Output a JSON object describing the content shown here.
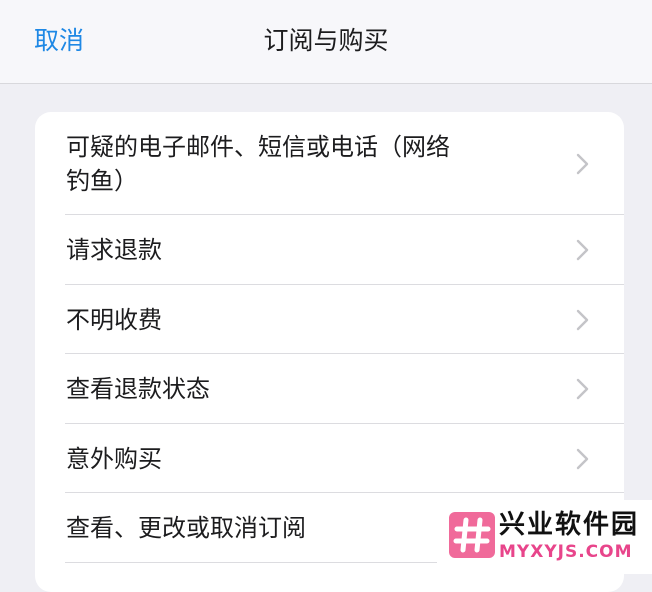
{
  "nav": {
    "cancel_label": "取消",
    "title": "订阅与购买"
  },
  "menu": {
    "items": [
      {
        "label": "可疑的电子邮件、短信或电话（网络钓鱼）",
        "lines": [
          "可疑的电子邮件、短信或电话（网络",
          "钓鱼）"
        ]
      },
      {
        "label": "请求退款"
      },
      {
        "label": "不明收费"
      },
      {
        "label": "查看退款状态"
      },
      {
        "label": "意外购买"
      },
      {
        "label": "查看、更改或取消订阅"
      }
    ]
  },
  "watermark": {
    "title": "兴业软件园",
    "subtitle": "MYXYJS.COM"
  },
  "colors": {
    "accent": "#1e88e5",
    "background": "#efeff4",
    "watermark_pink": "#e8458b"
  },
  "icons": {
    "chevron": "chevron-right-icon",
    "watermark_logo": "hash-logo-icon"
  }
}
